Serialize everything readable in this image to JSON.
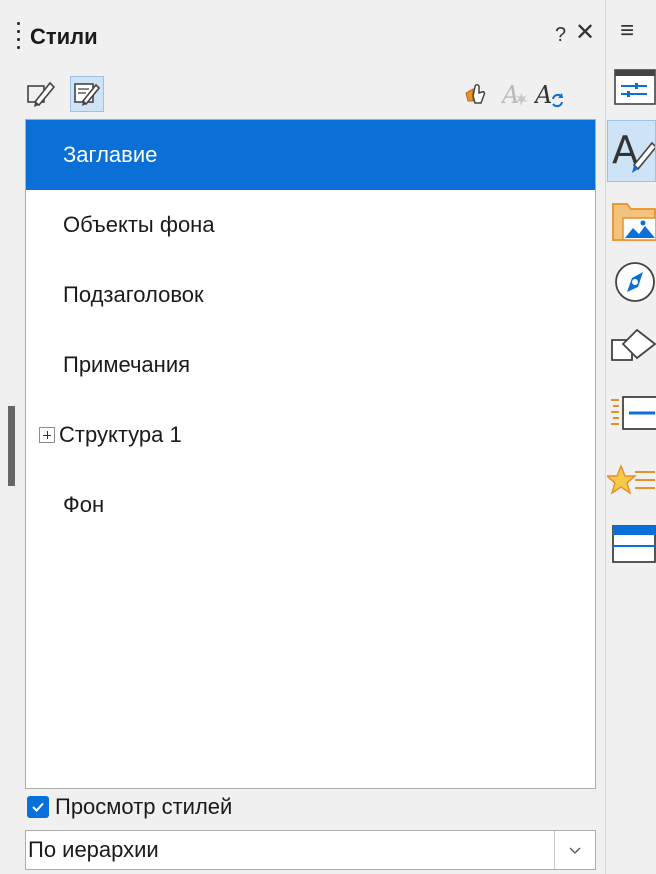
{
  "header": {
    "title": "Стили",
    "help_label": "?",
    "close_label": "✕",
    "menu_label": "≡"
  },
  "toolbar": {
    "left_tools": [
      "presentation-styles-icon",
      "drawing-styles-icon"
    ],
    "right_tools": [
      "fill-format-mode-icon",
      "new-style-from-selection-icon",
      "update-style-icon"
    ]
  },
  "styles_list": [
    {
      "label": "Заглавие",
      "selected": true,
      "expandable": false
    },
    {
      "label": "Объекты фона",
      "selected": false,
      "expandable": false
    },
    {
      "label": "Подзаголовок",
      "selected": false,
      "expandable": false
    },
    {
      "label": "Примечания",
      "selected": false,
      "expandable": false
    },
    {
      "label": "Структура 1",
      "selected": false,
      "expandable": true
    },
    {
      "label": "Фон",
      "selected": false,
      "expandable": false
    }
  ],
  "preview_checkbox": {
    "label": "Просмотр стилей",
    "checked": true
  },
  "filter": {
    "value": "По иерархии"
  },
  "sidebar": {
    "items": [
      "properties-icon",
      "styles-icon",
      "gallery-icon",
      "navigator-icon",
      "shapes-icon",
      "slide-transition-icon",
      "animation-icon",
      "master-slides-icon"
    ],
    "active": "styles-icon"
  },
  "colors": {
    "accent": "#0a6fd6",
    "orange": "#e8902a"
  }
}
